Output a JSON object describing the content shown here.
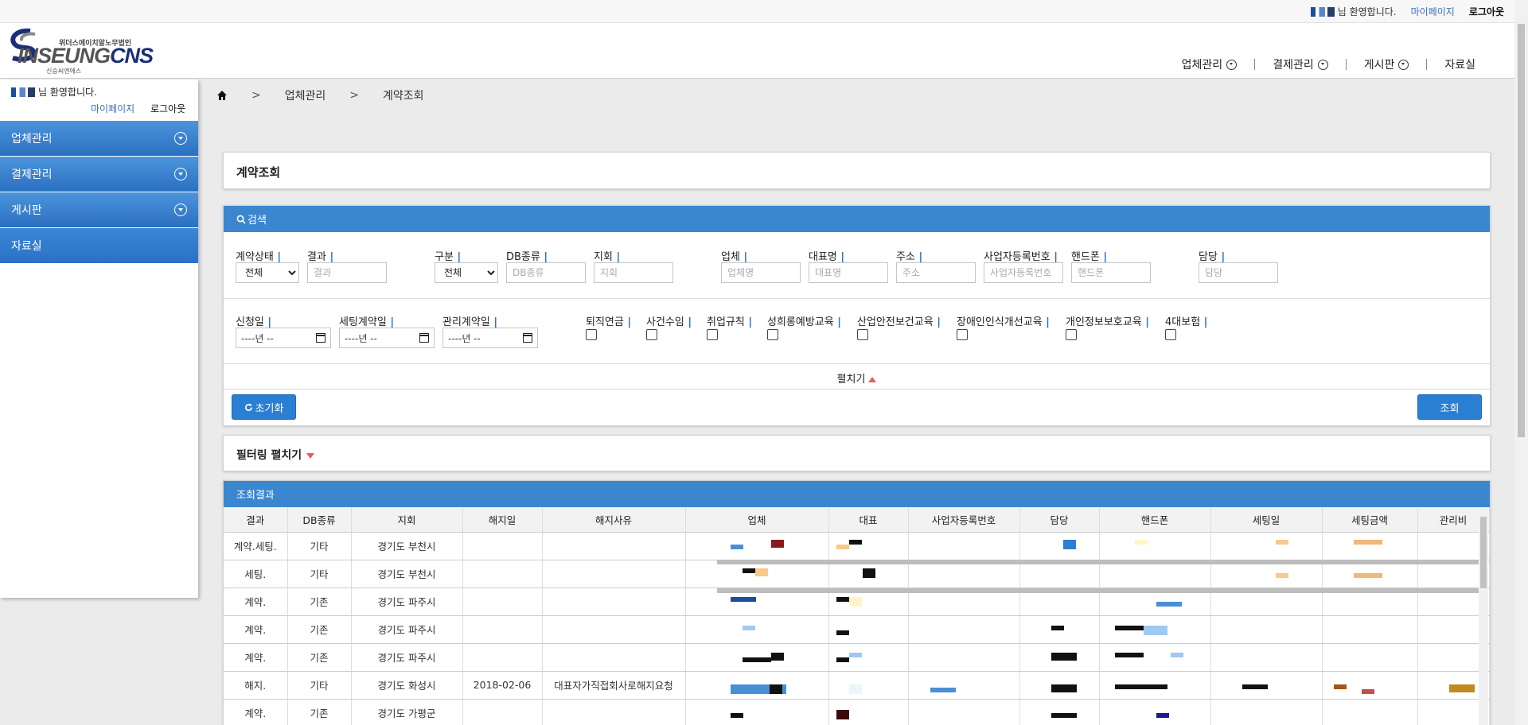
{
  "topbar": {
    "welcome": "님 환영합니다.",
    "mypage": "마이페이지",
    "logout": "로그아웃"
  },
  "logo": {
    "top_text": "위더스에이치알노무법인",
    "main_text_a": "INSEUNG",
    "main_text_b": "CNS",
    "bottom_text": "신승씨엔에스"
  },
  "mainnav": {
    "items": [
      {
        "label": "업체관리",
        "icon": "circle-chevron-down-icon"
      },
      {
        "label": "결제관리",
        "icon": "circle-chevron-down-icon"
      },
      {
        "label": "게시판",
        "icon": "circle-chevron-down-icon"
      },
      {
        "label": "자료실"
      }
    ]
  },
  "sidebar": {
    "welcome": "님 환영합니다.",
    "mypage": "마이페이지",
    "logout": "로그아웃",
    "items": [
      {
        "label": "업체관리"
      },
      {
        "label": "결제관리"
      },
      {
        "label": "게시판"
      },
      {
        "label": "자료실"
      }
    ]
  },
  "breadcrumb": {
    "items": [
      "업체관리",
      "계약조회"
    ],
    "separator": ">"
  },
  "page": {
    "title": "계약조회"
  },
  "search": {
    "header": "검색",
    "fields": {
      "contract_status": {
        "label": "계약상태",
        "value": "전체"
      },
      "result": {
        "label": "결과",
        "placeholder": "결과"
      },
      "category": {
        "label": "구분",
        "value": "전체"
      },
      "db_type": {
        "label": "DB종류",
        "placeholder": "DB종류"
      },
      "branch": {
        "label": "지회",
        "placeholder": "지회"
      },
      "company": {
        "label": "업체",
        "placeholder": "업체명"
      },
      "ceo": {
        "label": "대표명",
        "placeholder": "대표명"
      },
      "address": {
        "label": "주소",
        "placeholder": "주소"
      },
      "biz_no": {
        "label": "사업자등록번호",
        "placeholder": "사업자등록번호"
      },
      "phone": {
        "label": "핸드폰",
        "placeholder": "핸드폰"
      },
      "manager": {
        "label": "담당",
        "placeholder": "담당"
      },
      "apply_date": {
        "label": "신청일",
        "value": "----년 --"
      },
      "setting_date": {
        "label": "세팅계약일",
        "value": "----년 --"
      },
      "manage_date": {
        "label": "관리계약일",
        "value": "----년 --"
      }
    },
    "checkboxes": [
      {
        "label": "퇴직연금",
        "checked": false
      },
      {
        "label": "사건수임",
        "checked": false
      },
      {
        "label": "취업규칙",
        "checked": false
      },
      {
        "label": "성희롱예방교육",
        "checked": false
      },
      {
        "label": "산업안전보건교육",
        "checked": false
      },
      {
        "label": "장애인인식개선교육",
        "checked": false
      },
      {
        "label": "개인정보보호교육",
        "checked": false
      },
      {
        "label": "4대보험",
        "checked": false
      }
    ],
    "expand_label": "펼치기",
    "reset_label": "초기화",
    "search_label": "조회"
  },
  "filter": {
    "label": "필터링 펼치기"
  },
  "results": {
    "header": "조회결과",
    "columns": [
      "결과",
      "DB종류",
      "지회",
      "해지일",
      "해지사유",
      "업체",
      "대표",
      "사업자등록번호",
      "담당",
      "핸드폰",
      "세팅일",
      "세팅금액",
      "관리비"
    ],
    "rows": [
      [
        "계약.세팅.",
        "기타",
        "경기도 부천시",
        "",
        ""
      ],
      [
        "세팅.",
        "기타",
        "경기도 부천시",
        "",
        ""
      ],
      [
        "계약.",
        "기존",
        "경기도 파주시",
        "",
        ""
      ],
      [
        "계약.",
        "기존",
        "경기도 파주시",
        "",
        ""
      ],
      [
        "계약.",
        "기존",
        "경기도 파주시",
        "",
        ""
      ],
      [
        "해지.",
        "기타",
        "경기도 화성시",
        "2018-02-06",
        "대표자가직접회사로해지요청"
      ],
      [
        "계약.",
        "기존",
        "경기도 가평군",
        "",
        ""
      ]
    ]
  },
  "colors": {
    "primary_blue": "#3a87cf",
    "button_blue": "#2b7fd3",
    "sidebar_gradient_top": "#4d94dd",
    "sidebar_gradient_bottom": "#2a70c0",
    "accent_red_triangle": "#ef5a5a"
  }
}
